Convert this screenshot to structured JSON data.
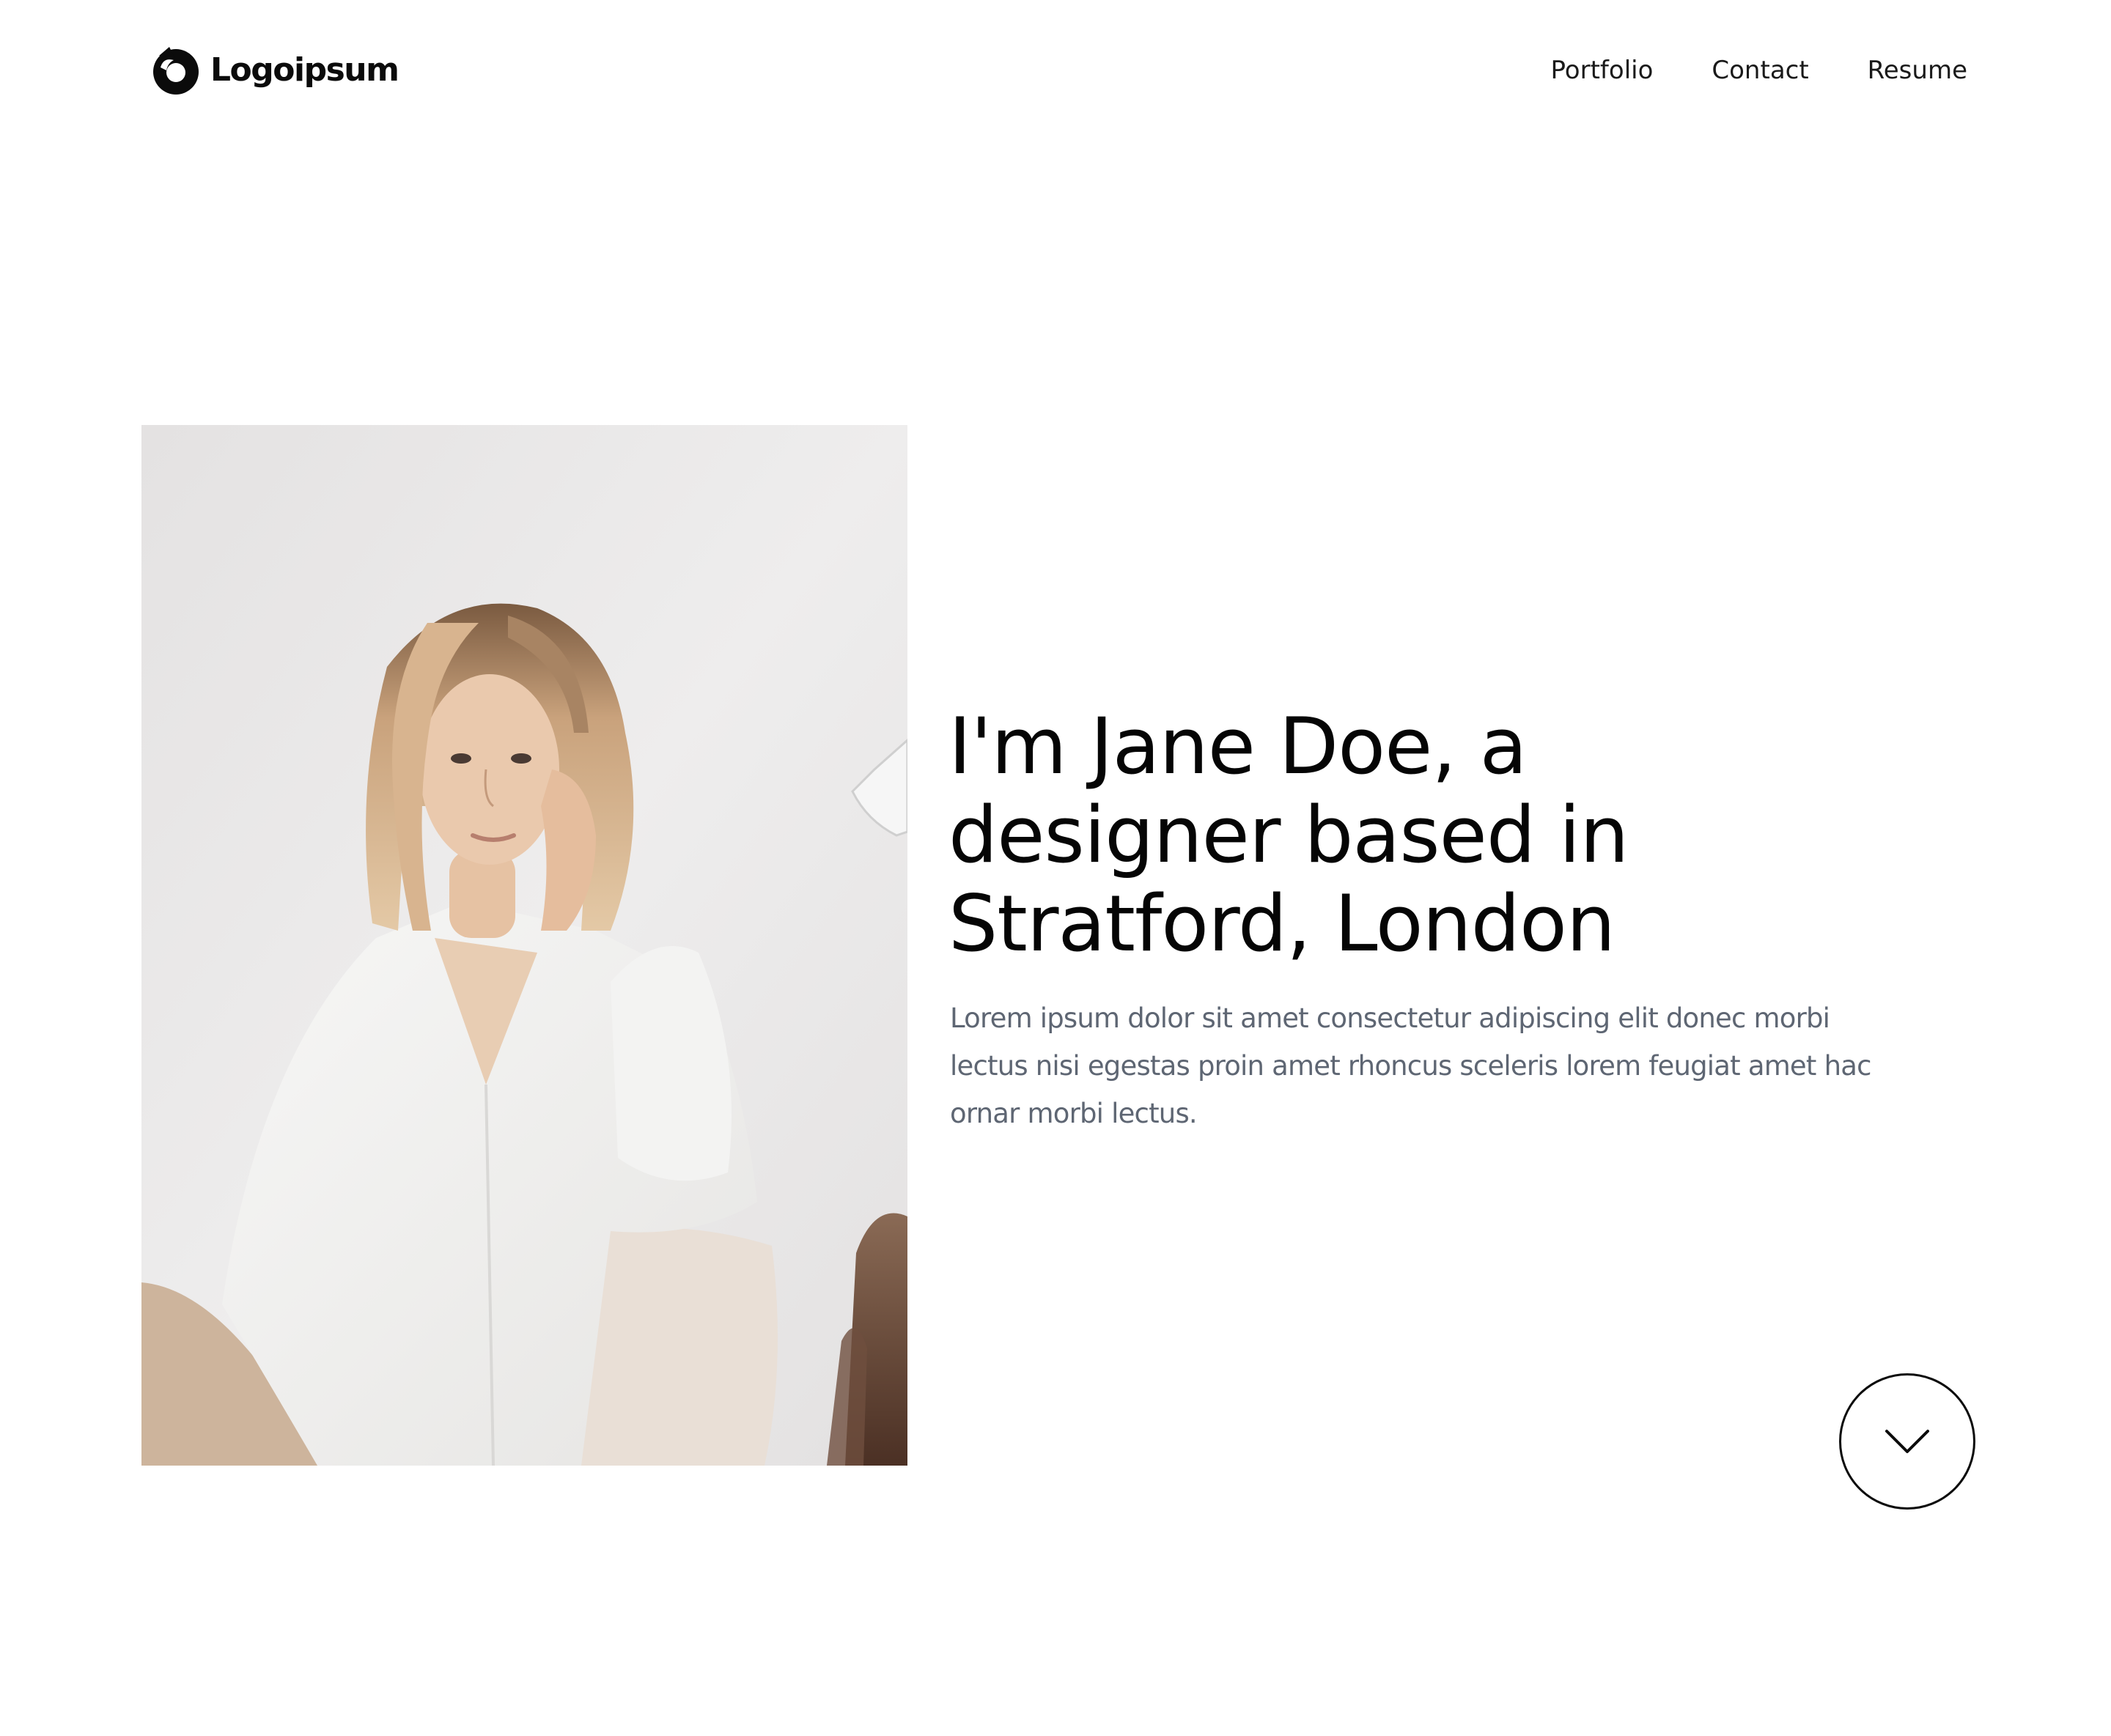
{
  "header": {
    "logo_text": "Logoipsum",
    "logo_icon": "logo-mark-icon",
    "nav": [
      {
        "label": "Portfolio"
      },
      {
        "label": "Contact"
      },
      {
        "label": "Resume"
      }
    ]
  },
  "hero": {
    "title_lines": [
      "I'm Jane Doe, a",
      "designer based in",
      "Stratford, London"
    ],
    "description_lines": [
      "Lorem ipsum dolor sit amet consectetur adipiscing elit donec morbi",
      "lectus nisi egestas proin amet rhoncus sceleris lorem feugiat amet hac",
      "ornar morbi lectus."
    ],
    "photo": "portrait-photo",
    "scroll_icon": "chevron-down-icon"
  },
  "colors": {
    "text": "#050505",
    "muted_text": "#5e6673",
    "background": "#ffffff"
  }
}
